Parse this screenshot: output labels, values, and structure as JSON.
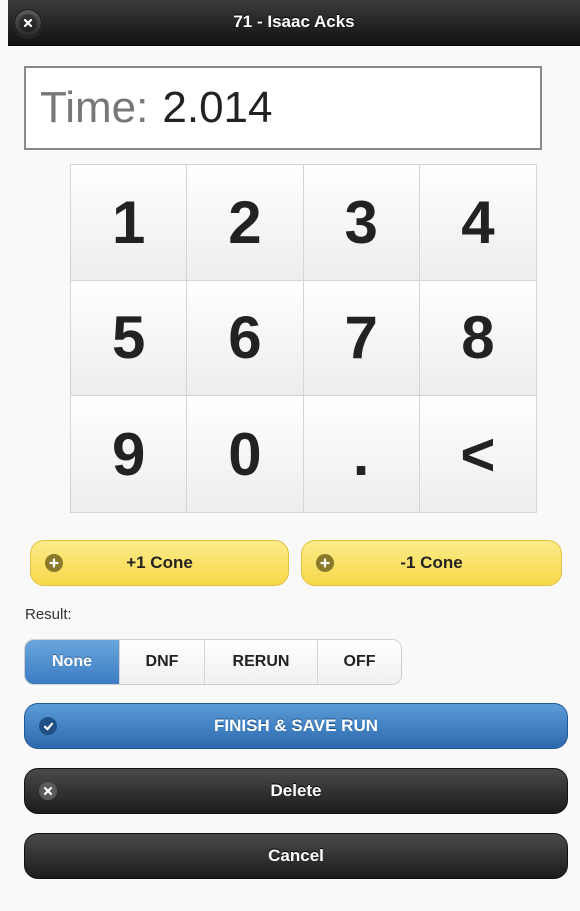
{
  "header": {
    "title": "71 - Isaac Acks",
    "close_icon": "close-icon"
  },
  "time": {
    "label": "Time:",
    "value": "2.014"
  },
  "keypad": {
    "keys": [
      "1",
      "2",
      "3",
      "4",
      "5",
      "6",
      "7",
      "8",
      "9",
      "0",
      ".",
      "<"
    ]
  },
  "cones": {
    "plus_label": "+1 Cone",
    "minus_label": "-1 Cone",
    "icon": "plus-icon"
  },
  "result": {
    "label": "Result:",
    "options": [
      "None",
      "DNF",
      "RERUN",
      "OFF"
    ],
    "selected": "None"
  },
  "actions": {
    "finish_label": "FINISH & SAVE RUN",
    "finish_icon": "check-icon",
    "delete_label": "Delete",
    "delete_icon": "close-icon",
    "cancel_label": "Cancel"
  },
  "colors": {
    "accent_blue": "#3a7cc2",
    "cone_yellow": "#f7d84a",
    "dark_button": "#1c1c1c",
    "header_bg": "#111111"
  }
}
